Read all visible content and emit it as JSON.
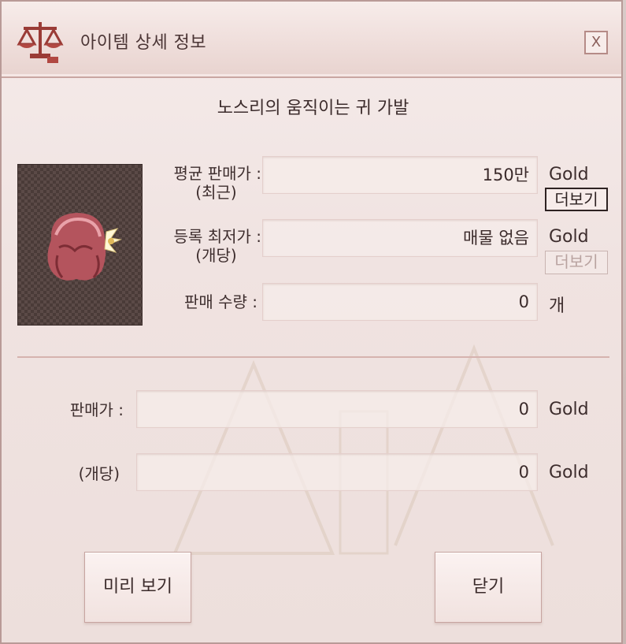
{
  "window": {
    "title": "아이템 상세 정보",
    "close_label": "X"
  },
  "item": {
    "name": "노스리의 움직이는 귀 가발"
  },
  "info": {
    "avg_price_label_1": "평균 판매가 :",
    "avg_price_label_2": "(최근)",
    "avg_price_value": "150만",
    "avg_price_unit": "Gold",
    "more_label_1": "더보기",
    "lowest_label_1": "등록 최저가 :",
    "lowest_label_2": "(개당)",
    "lowest_value": "매물 없음",
    "lowest_unit": "Gold",
    "more_label_2": "더보기",
    "qty_label": "판매 수량 :",
    "qty_value": "0",
    "qty_unit": "개"
  },
  "sell": {
    "price_label": "판매가 :",
    "price_value": "0",
    "price_unit": "Gold",
    "per_label": "(개당)",
    "per_value": "0",
    "per_unit": "Gold"
  },
  "buttons": {
    "preview": "미리 보기",
    "close": "닫기"
  }
}
